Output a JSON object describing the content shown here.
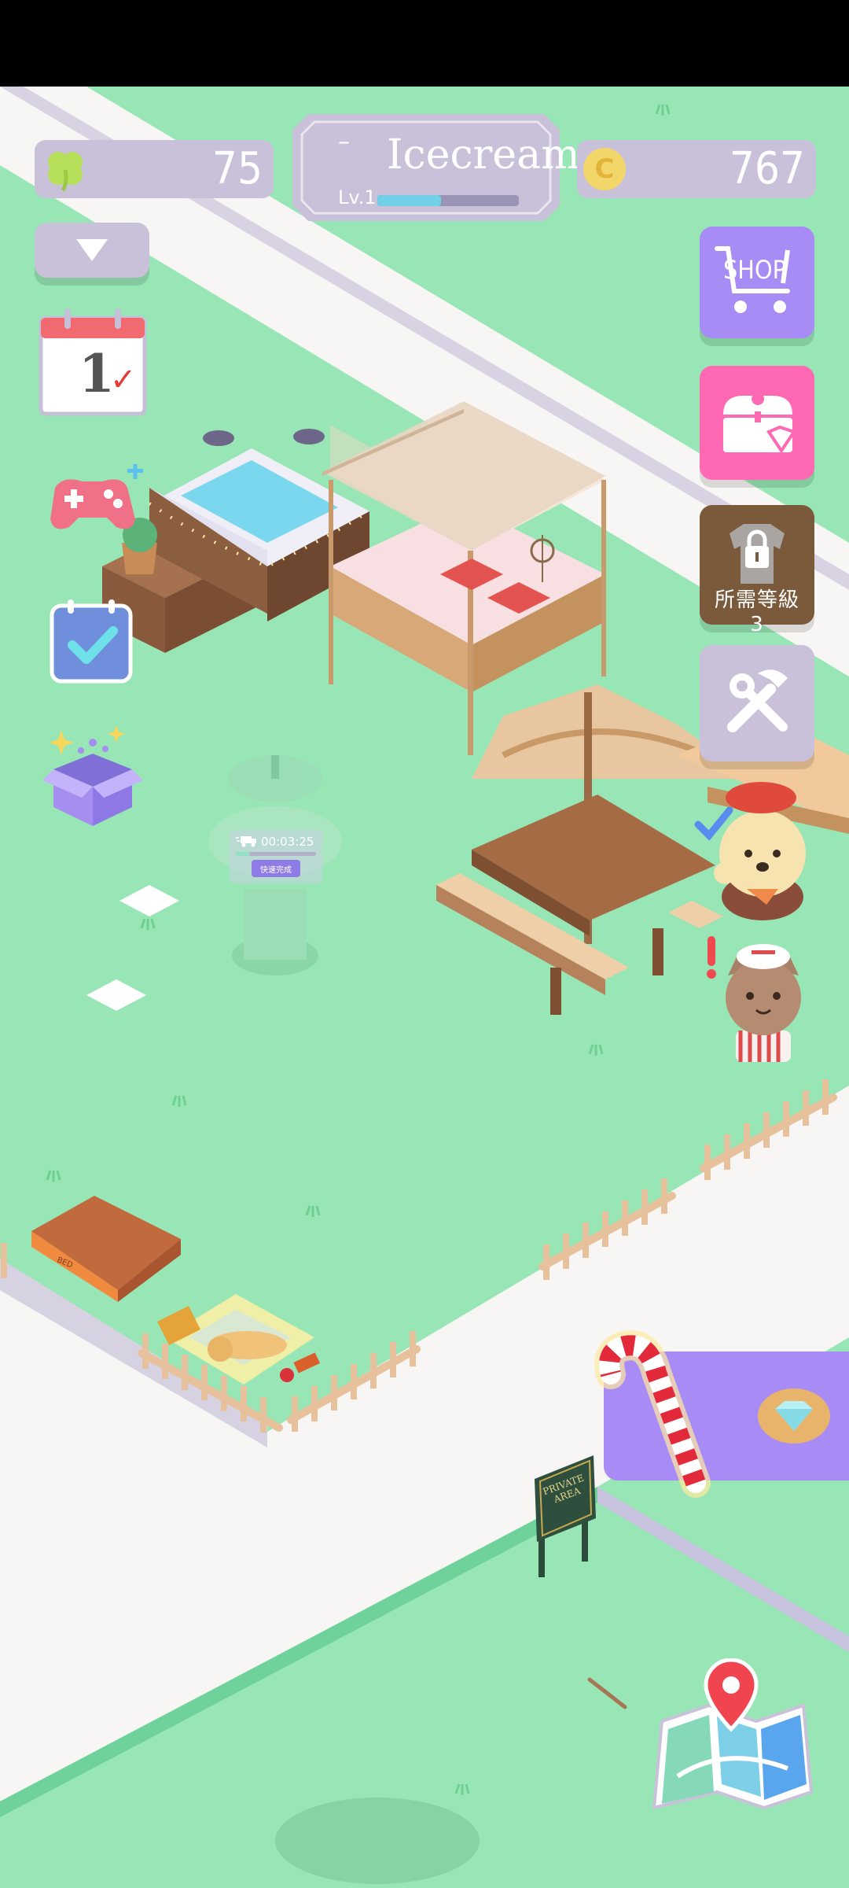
{
  "hud": {
    "clover_count": "75",
    "coin_count": "767",
    "coin_symbol": "C",
    "player_name": "Icecream",
    "level": "Lv.1",
    "xp_progress": 0.45,
    "name_dash": "–"
  },
  "side_left": {
    "calendar_day": "1",
    "calendar_check": "✓"
  },
  "side_right": {
    "shop_label": "SHOP",
    "locked_label": "所需等級 3"
  },
  "fountain": {
    "timer": "00:03:25",
    "button_label": "快速完成"
  },
  "signs": {
    "private_line1": "PRIVATE",
    "private_line2": "AREA",
    "pet_bed_tag": "BED"
  },
  "colors": {
    "grass": "#98e6b5",
    "path": "#f7f6f4",
    "hud_pill": "#c9c1d9",
    "shop_button": "#a78cf5",
    "gift_button": "#ff69b4",
    "locked_button": "#7a5a3a",
    "tools_button": "#c9c1d9",
    "promo_banner": "#a98bf5"
  },
  "icons": [
    "clover-icon",
    "coin-icon",
    "dropdown-arrow-icon",
    "calendar-icon",
    "gamepad-plus-icon",
    "checklist-icon",
    "mystery-box-icon",
    "shopping-cart-icon",
    "treasure-chest-icon",
    "lock-icon",
    "tools-icon",
    "map-pin-icon",
    "candy-cane-icon",
    "diamond-icon"
  ]
}
